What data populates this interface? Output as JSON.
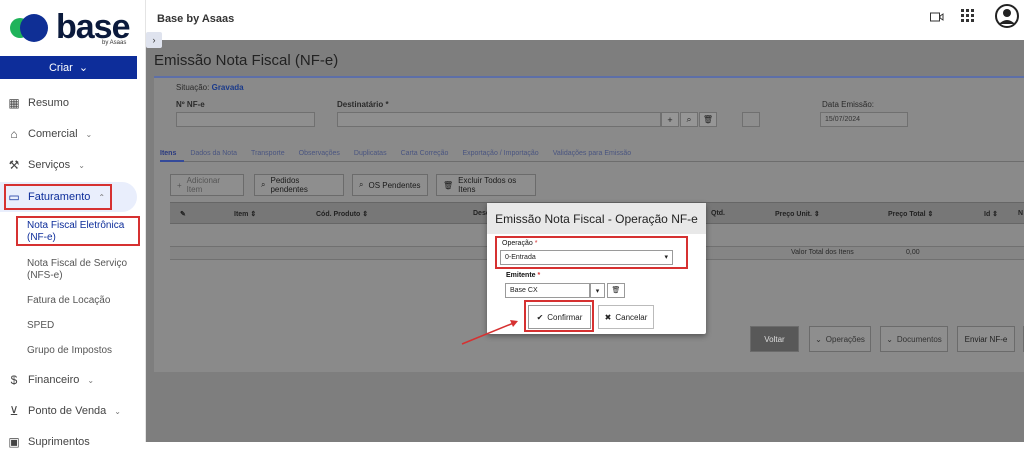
{
  "brand": {
    "name": "base",
    "by": "by Asaas",
    "app_title": "Base by Asaas"
  },
  "sidebar": {
    "create_label": "Criar",
    "items": [
      {
        "label": "Resumo",
        "icon": "dashboard-icon"
      },
      {
        "label": "Comercial",
        "icon": "store-icon"
      },
      {
        "label": "Serviços",
        "icon": "wrench-icon"
      },
      {
        "label": "Faturamento",
        "icon": "invoice-icon"
      },
      {
        "label": "Financeiro",
        "icon": "dollar-icon"
      },
      {
        "label": "Ponto de Venda",
        "icon": "cart-icon"
      },
      {
        "label": "Suprimentos",
        "icon": "box-icon"
      }
    ],
    "submenu": [
      "Nota Fiscal Eletrônica (NF-e)",
      "Nota Fiscal de Serviço (NFS-e)",
      "Fatura de Locação",
      "SPED",
      "Grupo de Impostos"
    ]
  },
  "page": {
    "title": "Emissão Nota Fiscal (NF-e)",
    "status_label": "Situação:",
    "status_value": "Gravada",
    "nfe_label": "Nº NF-e",
    "dest_label": "Destinatário *",
    "date_label": "Data Emissão:",
    "date_value": "15/07/2024",
    "tabs": [
      "Itens",
      "Dados da Nota",
      "Transporte",
      "Observações",
      "Duplicatas",
      "Carta Correção",
      "Exportação / Importação",
      "Validações para Emissão"
    ],
    "toolbar": {
      "add_item": "Adicionar Item",
      "pending_orders": "Pedidos pendentes",
      "pending_os": "OS Pendentes",
      "delete_all": "Excluir Todos os Itens"
    },
    "columns": [
      "Item",
      "Cód. Produto",
      "Desc",
      "Qtd.",
      "Preço Unit.",
      "Preço Total",
      "Id",
      "N"
    ],
    "total_label": "Valor Total dos Itens",
    "total_value": "0,00",
    "actions": {
      "back": "Voltar",
      "operations": "Operações",
      "documents": "Documentos",
      "send": "Enviar NF-e"
    }
  },
  "modal": {
    "title": "Emissão Nota Fiscal - Operação NF-e",
    "operation_label": "Operação",
    "operation_value": "0-Entrada",
    "issuer_label": "Emitente",
    "issuer_value": "Base CX",
    "confirm": "Confirmar",
    "cancel": "Cancelar",
    "required_mark": "*"
  },
  "colors": {
    "brand_blue": "#0d2d9a",
    "brand_green": "#1fb35a",
    "highlight_red": "#d63131",
    "status_green": "#2a6f1f"
  }
}
